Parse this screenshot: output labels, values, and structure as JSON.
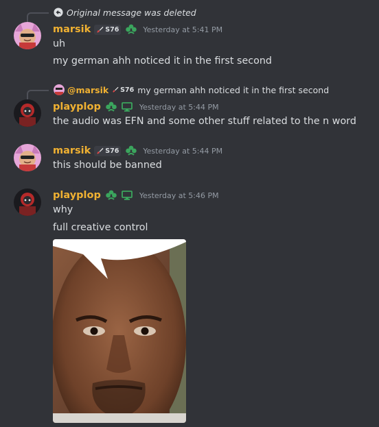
{
  "reply_deleted": {
    "text": "Original message was deleted"
  },
  "messages": [
    {
      "username": "marsik",
      "tag": "S76",
      "timestamp": "Yesterday at 5:41 PM",
      "lines": [
        "uh",
        "my german ahh noticed it in the first second"
      ]
    },
    {
      "reply": {
        "mention": "@marsik",
        "tag": "S76",
        "text": "my german ahh noticed it in the first second"
      },
      "username": "playplop",
      "timestamp": "Yesterday at 5:44 PM",
      "lines": [
        "the audio was EFN and some other stuff related to the n word"
      ]
    },
    {
      "username": "marsik",
      "tag": "S76",
      "timestamp": "Yesterday at 5:44 PM",
      "lines": [
        "this should be banned"
      ]
    },
    {
      "username": "playplop",
      "timestamp": "Yesterday at 5:46 PM",
      "lines": [
        "why",
        "full creative control"
      ]
    }
  ],
  "colors": {
    "background": "#313338",
    "username": "#f0b132",
    "timestamp": "#949ba4",
    "text": "#dbdee1",
    "badge_green": "#3ba55d"
  },
  "icons": [
    "reply-arrow-icon",
    "sword-icon",
    "clover-badge-icon",
    "desktop-icon"
  ]
}
